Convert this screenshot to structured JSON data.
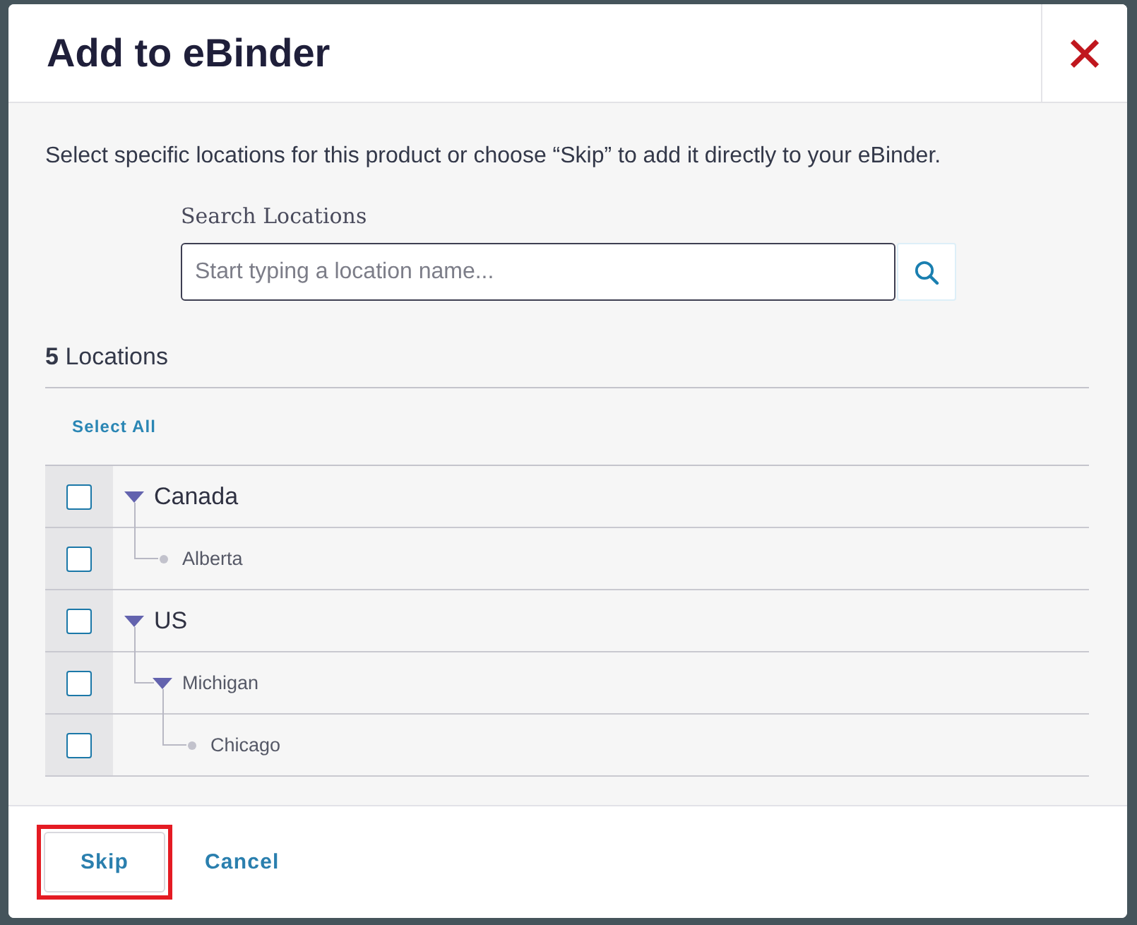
{
  "dialog": {
    "title": "Add to eBinder"
  },
  "description": "Select specific locations for this product or choose “Skip” to add it directly to your eBinder.",
  "search": {
    "label": "Search Locations",
    "placeholder": "Start typing a location name..."
  },
  "count": "**5** Locations",
  "select_all": "Select All",
  "locations": [
    {
      "name": "Canada",
      "checked": false,
      "expanded": true,
      "children": [
        {
          "name": "Alberta",
          "checked": false
        }
      ]
    },
    {
      "name": "US",
      "checked": false,
      "expanded": true,
      "children": [
        {
          "name": "Michigan",
          "checked": false,
          "expanded": true,
          "children": [
            {
              "name": "Chicago",
              "checked": false
            }
          ]
        }
      ]
    }
  ],
  "buttons": [
    {
      "label": "Skip",
      "kind": "secondary",
      "highlighted": true
    },
    {
      "label": "Cancel",
      "kind": "link",
      "highlighted": false
    }
  ]
}
